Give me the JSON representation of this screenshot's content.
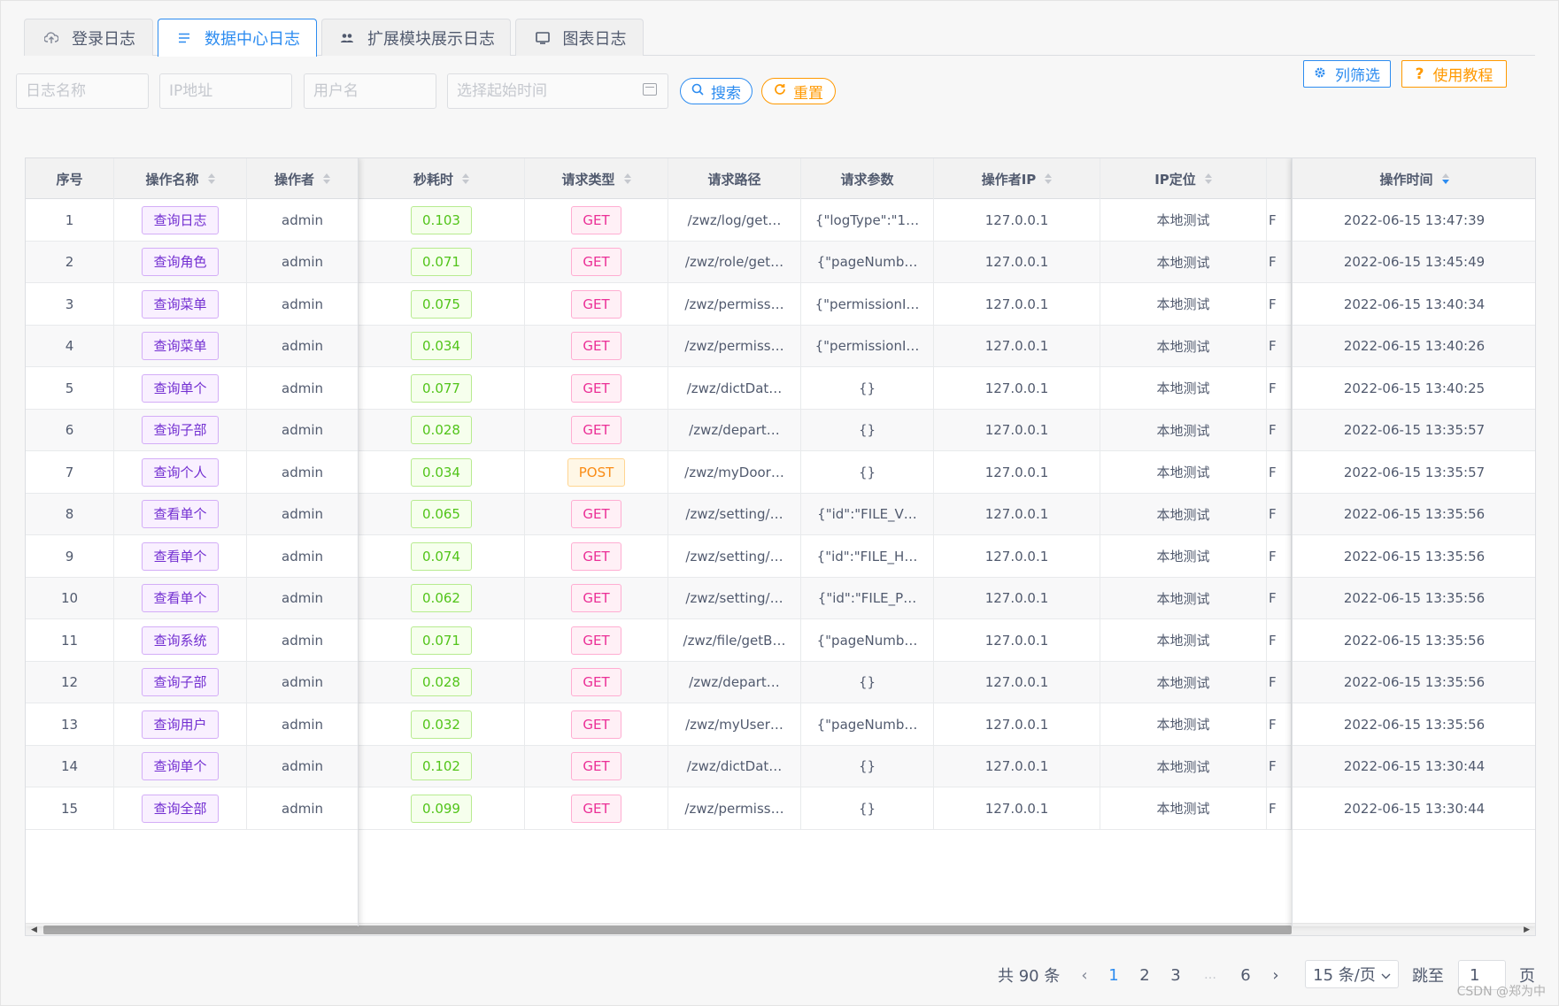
{
  "tabs": [
    {
      "label": "登录日志",
      "icon": "cloud-upload-icon"
    },
    {
      "label": "数据中心日志",
      "icon": "list-icon"
    },
    {
      "label": "扩展模块展示日志",
      "icon": "users-icon"
    },
    {
      "label": "图表日志",
      "icon": "monitor-icon"
    }
  ],
  "active_tab": 1,
  "filters": {
    "log_name_placeholder": "日志名称",
    "ip_placeholder": "IP地址",
    "user_placeholder": "用户名",
    "date_placeholder": "选择起始时间",
    "search_label": "搜索",
    "reset_label": "重置"
  },
  "toolbar": {
    "column_filter_label": "列筛选",
    "tutorial_label": "使用教程"
  },
  "table": {
    "headers": [
      "序号",
      "操作名称",
      "操作者",
      "秒耗时",
      "请求类型",
      "请求路径",
      "请求参数",
      "操作者IP",
      "IP定位",
      "",
      "操作时间"
    ],
    "partial_cell": "F",
    "rows": [
      {
        "no": "1",
        "op": "查询日志",
        "user": "admin",
        "time": "0.103",
        "method": "GET",
        "path": "/zwz/log/get…",
        "params": "{\"logType\":\"1…",
        "ip": "127.0.0.1",
        "loc": "本地测试",
        "datetime": "2022-06-15 13:47:39"
      },
      {
        "no": "2",
        "op": "查询角色",
        "user": "admin",
        "time": "0.071",
        "method": "GET",
        "path": "/zwz/role/get…",
        "params": "{\"pageNumb…",
        "ip": "127.0.0.1",
        "loc": "本地测试",
        "datetime": "2022-06-15 13:45:49"
      },
      {
        "no": "3",
        "op": "查询菜单",
        "user": "admin",
        "time": "0.075",
        "method": "GET",
        "path": "/zwz/permiss…",
        "params": "{\"permissionI…",
        "ip": "127.0.0.1",
        "loc": "本地测试",
        "datetime": "2022-06-15 13:40:34"
      },
      {
        "no": "4",
        "op": "查询菜单",
        "user": "admin",
        "time": "0.034",
        "method": "GET",
        "path": "/zwz/permiss…",
        "params": "{\"permissionI…",
        "ip": "127.0.0.1",
        "loc": "本地测试",
        "datetime": "2022-06-15 13:40:26"
      },
      {
        "no": "5",
        "op": "查询单个",
        "user": "admin",
        "time": "0.077",
        "method": "GET",
        "path": "/zwz/dictDat…",
        "params": "{}",
        "ip": "127.0.0.1",
        "loc": "本地测试",
        "datetime": "2022-06-15 13:40:25"
      },
      {
        "no": "6",
        "op": "查询子部",
        "user": "admin",
        "time": "0.028",
        "method": "GET",
        "path": "/zwz/depart…",
        "params": "{}",
        "ip": "127.0.0.1",
        "loc": "本地测试",
        "datetime": "2022-06-15 13:35:57"
      },
      {
        "no": "7",
        "op": "查询个人",
        "user": "admin",
        "time": "0.034",
        "method": "POST",
        "path": "/zwz/myDoor…",
        "params": "{}",
        "ip": "127.0.0.1",
        "loc": "本地测试",
        "datetime": "2022-06-15 13:35:57"
      },
      {
        "no": "8",
        "op": "查看单个",
        "user": "admin",
        "time": "0.065",
        "method": "GET",
        "path": "/zwz/setting/…",
        "params": "{\"id\":\"FILE_V…",
        "ip": "127.0.0.1",
        "loc": "本地测试",
        "datetime": "2022-06-15 13:35:56"
      },
      {
        "no": "9",
        "op": "查看单个",
        "user": "admin",
        "time": "0.074",
        "method": "GET",
        "path": "/zwz/setting/…",
        "params": "{\"id\":\"FILE_H…",
        "ip": "127.0.0.1",
        "loc": "本地测试",
        "datetime": "2022-06-15 13:35:56"
      },
      {
        "no": "10",
        "op": "查看单个",
        "user": "admin",
        "time": "0.062",
        "method": "GET",
        "path": "/zwz/setting/…",
        "params": "{\"id\":\"FILE_P…",
        "ip": "127.0.0.1",
        "loc": "本地测试",
        "datetime": "2022-06-15 13:35:56"
      },
      {
        "no": "11",
        "op": "查询系统",
        "user": "admin",
        "time": "0.071",
        "method": "GET",
        "path": "/zwz/file/getB…",
        "params": "{\"pageNumb…",
        "ip": "127.0.0.1",
        "loc": "本地测试",
        "datetime": "2022-06-15 13:35:56"
      },
      {
        "no": "12",
        "op": "查询子部",
        "user": "admin",
        "time": "0.028",
        "method": "GET",
        "path": "/zwz/depart…",
        "params": "{}",
        "ip": "127.0.0.1",
        "loc": "本地测试",
        "datetime": "2022-06-15 13:35:56"
      },
      {
        "no": "13",
        "op": "查询用户",
        "user": "admin",
        "time": "0.032",
        "method": "GET",
        "path": "/zwz/myUser…",
        "params": "{\"pageNumb…",
        "ip": "127.0.0.1",
        "loc": "本地测试",
        "datetime": "2022-06-15 13:35:56"
      },
      {
        "no": "14",
        "op": "查询单个",
        "user": "admin",
        "time": "0.102",
        "method": "GET",
        "path": "/zwz/dictDat…",
        "params": "{}",
        "ip": "127.0.0.1",
        "loc": "本地测试",
        "datetime": "2022-06-15 13:30:44"
      },
      {
        "no": "15",
        "op": "查询全部",
        "user": "admin",
        "time": "0.099",
        "method": "GET",
        "path": "/zwz/permiss…",
        "params": "{}",
        "ip": "127.0.0.1",
        "loc": "本地测试",
        "datetime": "2022-06-15 13:30:44"
      }
    ]
  },
  "pagination": {
    "total_label": "共 90 条",
    "pages": [
      "1",
      "2",
      "3",
      "…",
      "6"
    ],
    "current_page": "1",
    "page_size_label": "15 条/页",
    "jump_label": "跳至",
    "jump_value": "1",
    "page_unit": "页"
  },
  "watermark": "CSDN @郑为中",
  "colors": {
    "primary": "#2d8cf0",
    "warning": "#ff9900",
    "tag_purple": "#722ed1",
    "tag_green": "#52c41a",
    "tag_pink": "#eb2f96",
    "tag_orange": "#fa8c16"
  }
}
